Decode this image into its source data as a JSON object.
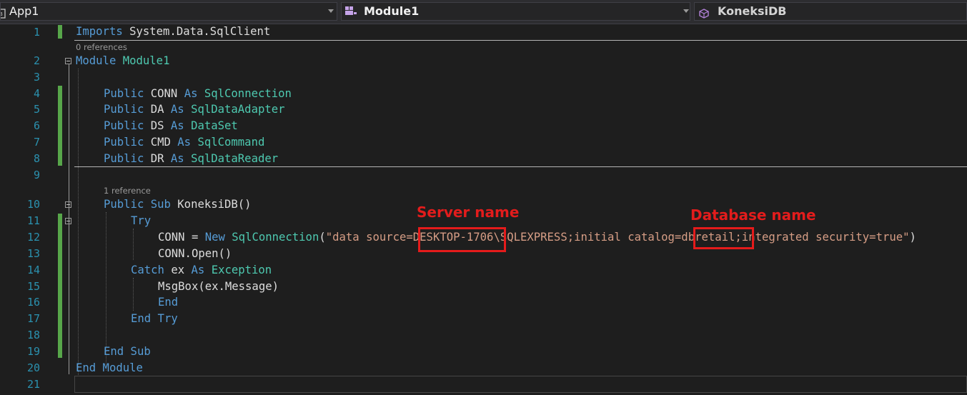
{
  "navbar": {
    "project": "App1",
    "module": "Module1",
    "member": "KoneksiDB"
  },
  "codelens": {
    "module_refs": "0 references",
    "sub_refs": "1 reference"
  },
  "lines": [
    {
      "n": "1"
    },
    {
      "n": "2"
    },
    {
      "n": "3"
    },
    {
      "n": "4"
    },
    {
      "n": "5"
    },
    {
      "n": "6"
    },
    {
      "n": "7"
    },
    {
      "n": "8"
    },
    {
      "n": "9"
    },
    {
      "n": "10"
    },
    {
      "n": "11"
    },
    {
      "n": "12"
    },
    {
      "n": "13"
    },
    {
      "n": "14"
    },
    {
      "n": "15"
    },
    {
      "n": "16"
    },
    {
      "n": "17"
    },
    {
      "n": "18"
    },
    {
      "n": "19"
    },
    {
      "n": "20"
    },
    {
      "n": "21"
    }
  ],
  "code": {
    "l1": {
      "kw1": "Imports",
      "t1": " System.Data.SqlClient"
    },
    "l2": {
      "kw1": "Module",
      "t1": " ",
      "ty1": "Module1"
    },
    "l4": {
      "kw1": "Public",
      "t1": " CONN ",
      "kw2": "As",
      "t2": " ",
      "ty1": "SqlConnection"
    },
    "l5": {
      "kw1": "Public",
      "t1": " DA ",
      "kw2": "As",
      "t2": " ",
      "ty1": "SqlDataAdapter"
    },
    "l6": {
      "kw1": "Public",
      "t1": " DS ",
      "kw2": "As",
      "t2": " ",
      "ty1": "DataSet"
    },
    "l7": {
      "kw1": "Public",
      "t1": " CMD ",
      "kw2": "As",
      "t2": " ",
      "ty1": "SqlCommand"
    },
    "l8": {
      "kw1": "Public",
      "t1": " DR ",
      "kw2": "As",
      "t2": " ",
      "ty1": "SqlDataReader"
    },
    "l10": {
      "kw1": "Public",
      "t1": " ",
      "kw2": "Sub",
      "t2": " KoneksiDB()"
    },
    "l11": {
      "kw1": "Try"
    },
    "l12": {
      "t1": "CONN = ",
      "kw1": "New",
      "t2": " ",
      "ty1": "SqlConnection",
      "t3": "(",
      "str1": "\"data source=DESKTOP-1706\\SQLEXPRESS;initial catalog=dbretail;integrated security=true\"",
      "t4": ")"
    },
    "l13": {
      "t1": "CONN.Open()"
    },
    "l14": {
      "kw1": "Catch",
      "t1": " ex ",
      "kw2": "As",
      "t2": " ",
      "ty1": "Exception"
    },
    "l15": {
      "t1": "MsgBox(ex.Message)"
    },
    "l16": {
      "kw1": "End"
    },
    "l17": {
      "kw1": "End Try"
    },
    "l19": {
      "kw1": "End Sub"
    },
    "l20": {
      "kw1": "End Module"
    }
  },
  "annotations": {
    "server": "Server name",
    "database": "Database name",
    "color": "#e31c1c"
  },
  "colors": {
    "keyword": "#569cd6",
    "type": "#4ec9b0",
    "string": "#d69d85",
    "line_number": "#2b91af",
    "change_bar": "#57a64a"
  }
}
